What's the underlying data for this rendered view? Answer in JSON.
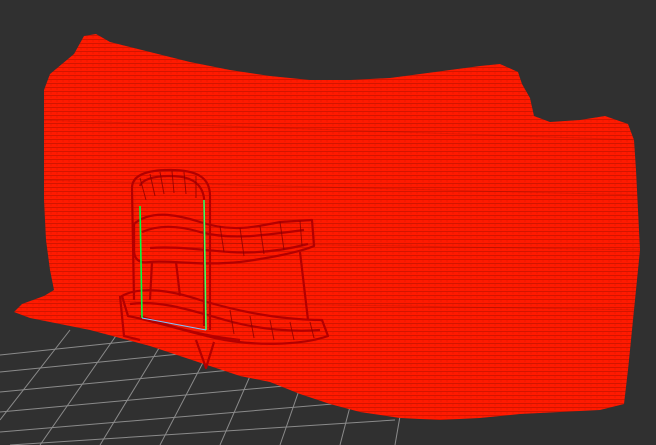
{
  "viewer": {
    "background_color": "#303030",
    "grid_color": "#a0a0a0",
    "cloud_colormap": [
      "#7f00ff",
      "#0000ff",
      "#00ffff",
      "#00ff00",
      "#ffff00",
      "#ff8000",
      "#ff0000"
    ],
    "object_wireframe_color": "#b40000",
    "axis_colors": [
      "#00ff40",
      "#80c0ff"
    ],
    "icons": [
      "point-cloud",
      "grid-floor",
      "wireframe-object"
    ]
  }
}
